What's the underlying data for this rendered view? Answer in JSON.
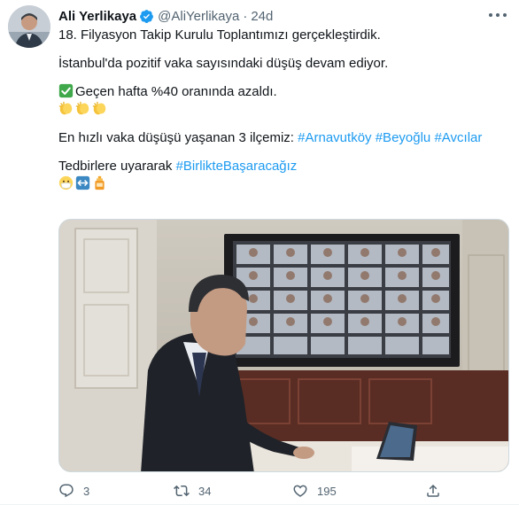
{
  "tweet": {
    "author_name": "Ali Yerlikaya",
    "handle": "@AliYerlikaya",
    "separator": "·",
    "time": "24d",
    "lines": [
      "18. Filyasyon Takip Kurulu Toplantımızı gerçekleştirdik.",
      "İstanbul'da pozitif vaka sayısındaki düşüş devam ediyor.",
      "Geçen hafta %40 oranında azaldı.",
      "En hızlı vaka düşüşü yaşanan 3 ilçemiz:",
      "Tedbirlere uyararak"
    ],
    "hashtags": [
      "#Arnavutköy",
      "#Beyoğlu",
      "#Avcılar"
    ],
    "hashtag_together": "#BirlikteBaşaracağız",
    "icons": {
      "check": "check-mark-button-icon",
      "clap": "clapping-hands-icon",
      "mask": "face-with-medical-mask-icon",
      "arrows": "left-right-arrow-icon",
      "sanitizer": "lotion-bottle-icon"
    }
  },
  "actions": {
    "reply_count": "3",
    "retweet_count": "34",
    "like_count": "195"
  },
  "colors": {
    "link": "#1d9bf0",
    "secondary_text": "#536471",
    "verified": "#1d9bf0"
  }
}
